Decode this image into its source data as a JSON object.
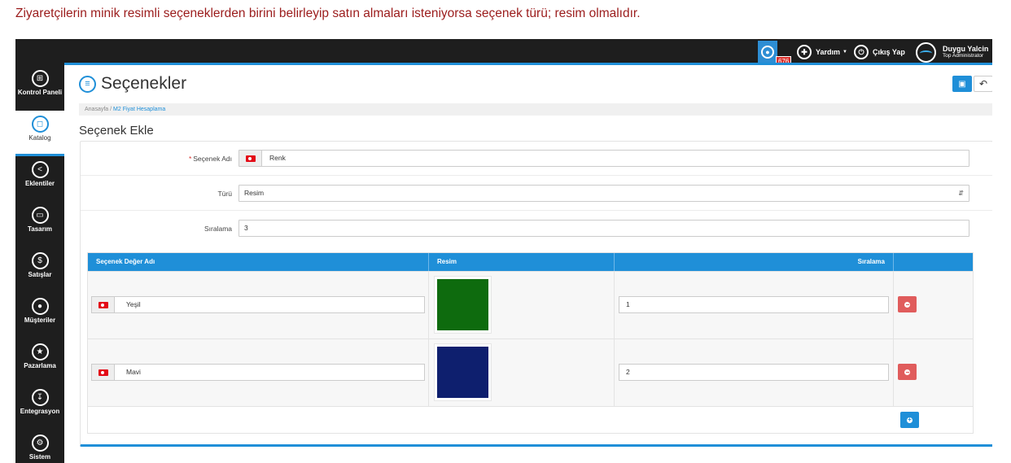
{
  "caption": "Ziyaretçilerin minik resimli seçeneklerden birini belirleyip satın almaları isteniyorsa seçenek türü; resim olmalıdır.",
  "topbar": {
    "notification_count": "676",
    "help_label": "Yardım",
    "logout_label": "Çıkış Yap",
    "user_name": "Duygu Yalcin",
    "user_role": "Top Administrator"
  },
  "sidebar": {
    "items": [
      {
        "label": "Kontrol Paneli",
        "icon": "dashboard-icon"
      },
      {
        "label": "Katalog",
        "icon": "catalog-icon",
        "active": true
      },
      {
        "label": "Eklentiler",
        "icon": "extensions-icon"
      },
      {
        "label": "Tasarım",
        "icon": "design-icon"
      },
      {
        "label": "Satışlar",
        "icon": "sales-icon"
      },
      {
        "label": "Müşteriler",
        "icon": "customers-icon"
      },
      {
        "label": "Pazarlama",
        "icon": "marketing-icon"
      },
      {
        "label": "Entegrasyon",
        "icon": "integration-icon"
      },
      {
        "label": "Sistem",
        "icon": "system-icon"
      }
    ]
  },
  "page": {
    "title": "Seçenekler",
    "breadcrumb_home": "Anasayfa",
    "breadcrumb_sep": "/",
    "breadcrumb_current": "M2 Fiyat Hesaplama",
    "section_title": "Seçenek Ekle"
  },
  "form": {
    "name_label": "Seçenek Adı",
    "name_value": "Renk",
    "type_label": "Türü",
    "type_value": "Resim",
    "order_label": "Sıralama",
    "order_value": "3"
  },
  "values_table": {
    "headers": [
      "Seçenek Değer Adı",
      "Resim",
      "Sıralama"
    ],
    "rows": [
      {
        "name": "Yeşil",
        "color": "#0e6b0e",
        "order": "1"
      },
      {
        "name": "Mavi",
        "color": "#0e1f6e",
        "order": "2"
      }
    ]
  },
  "colors": {
    "accent": "#1f8fd8",
    "danger": "#e05c5c",
    "caption": "#9b1c1c"
  }
}
